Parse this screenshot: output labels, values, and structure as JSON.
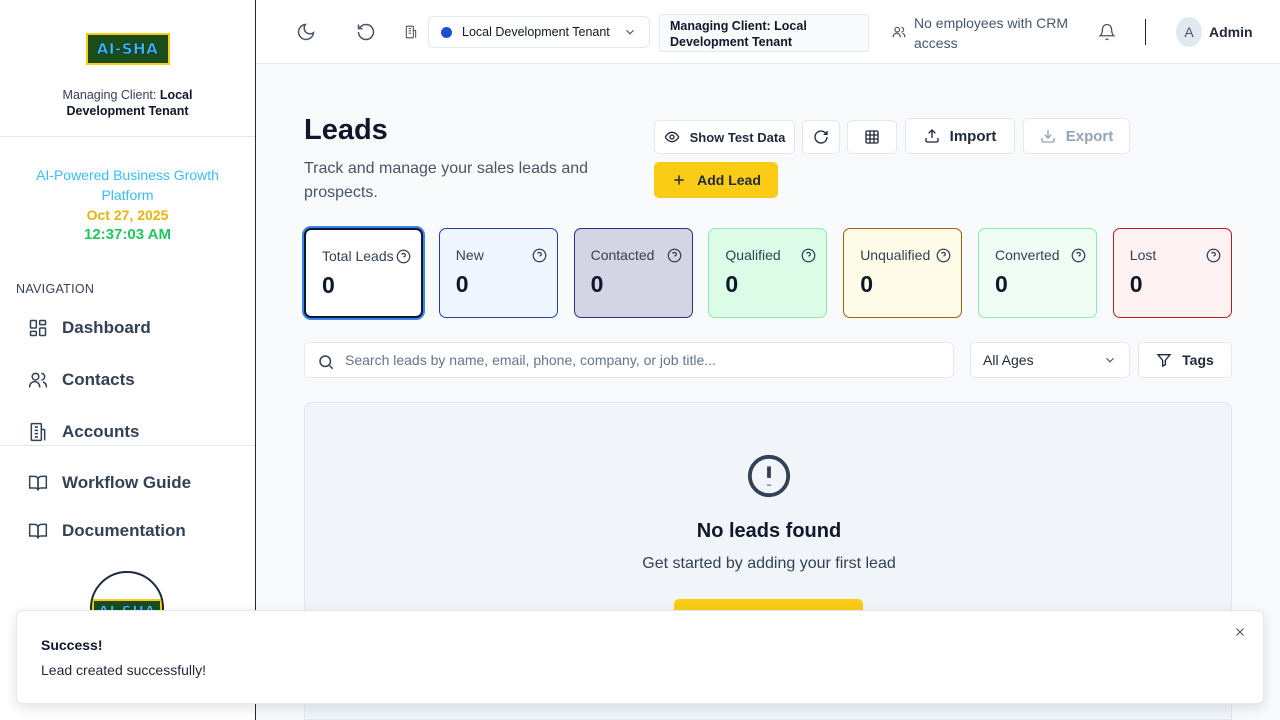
{
  "sidebar": {
    "logo_text": "AI-SHA",
    "managing_prefix": "Managing Client: ",
    "managing_client": "Local Development Tenant",
    "tagline": "AI-Powered Business Growth Platform",
    "date": "Oct 27, 2025",
    "time": "12:37:03 AM",
    "nav_heading": "NAVIGATION",
    "nav_items": [
      {
        "label": "Dashboard",
        "icon": "dashboard-icon"
      },
      {
        "label": "Contacts",
        "icon": "users-icon"
      },
      {
        "label": "Accounts",
        "icon": "building-icon"
      }
    ],
    "bottom_items": [
      {
        "label": "Workflow Guide",
        "icon": "book-icon"
      },
      {
        "label": "Documentation",
        "icon": "book-icon"
      }
    ]
  },
  "header": {
    "tenant": "Local Development Tenant",
    "managing_client": "Managing Client: Local Development Tenant",
    "employee_notice": "No employees with CRM access",
    "avatar_initial": "A",
    "user_name": "Admin"
  },
  "page": {
    "title": "Leads",
    "description": "Track and manage your sales leads and prospects."
  },
  "toolbar": {
    "show_test_data": "Show Test Data",
    "import": "Import",
    "export": "Export",
    "add_lead": "Add Lead"
  },
  "stats": [
    {
      "label": "Total Leads",
      "value": "0",
      "bg": "#ffffff",
      "border": "#0f172a"
    },
    {
      "label": "New",
      "value": "0",
      "bg": "#eff6ff",
      "border": "#1e40af"
    },
    {
      "label": "Contacted",
      "value": "0",
      "bg": "#d4d4e4",
      "border": "#312e81"
    },
    {
      "label": "Qualified",
      "value": "0",
      "bg": "#dcfce7",
      "border": "#86efac"
    },
    {
      "label": "Unqualified",
      "value": "0",
      "bg": "#fefce8",
      "border": "#a16207"
    },
    {
      "label": "Converted",
      "value": "0",
      "bg": "#f0fdf4",
      "border": "#86efac"
    },
    {
      "label": "Lost",
      "value": "0",
      "bg": "#fef2f2",
      "border": "#b91c1c"
    }
  ],
  "filters": {
    "search_placeholder": "Search leads by name, email, phone, company, or job title...",
    "age_filter": "All Ages",
    "tags": "Tags"
  },
  "empty_state": {
    "title": "No leads found",
    "subtitle": "Get started by adding your first lead"
  },
  "toast": {
    "title": "Success!",
    "message": "Lead created successfully!"
  }
}
